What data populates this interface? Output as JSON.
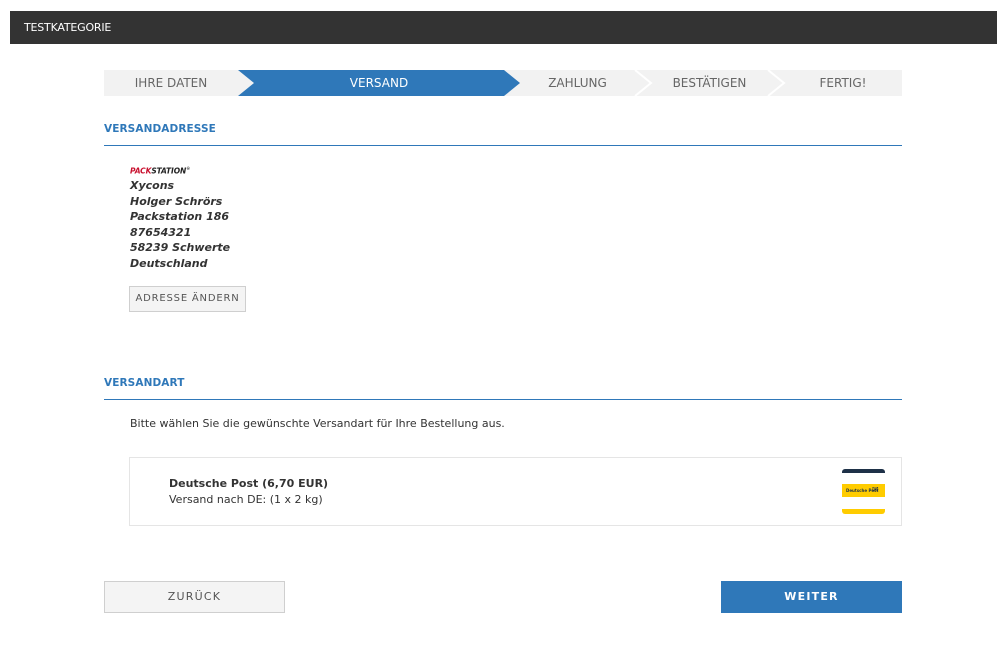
{
  "header": {
    "title": "TESTKATEGORIE"
  },
  "checkout_steps": [
    {
      "label": "IHRE DATEN",
      "active": false
    },
    {
      "label": "VERSAND",
      "active": true
    },
    {
      "label": "ZAHLUNG",
      "active": false
    },
    {
      "label": "BESTÄTIGEN",
      "active": false
    },
    {
      "label": "FERTIG!",
      "active": false
    }
  ],
  "shipping_address": {
    "section_title": "VERSANDADRESSE",
    "logo": {
      "pack": "PACK",
      "station": "STATION"
    },
    "lines": [
      "Xycons",
      "Holger Schrörs",
      "Packstation 186",
      "87654321",
      "58239 Schwerte",
      "Deutschland"
    ],
    "change_button": "ADRESSE ÄNDERN"
  },
  "shipping_method": {
    "section_title": "VERSANDART",
    "instruction": "Bitte wählen Sie die gewünschte Versandart für Ihre Bestellung aus.",
    "options": [
      {
        "name": "Deutsche Post (6,70 EUR)",
        "description": "Versand nach DE: (1 x 2 kg)",
        "logo_text": "Deutsche Post"
      }
    ]
  },
  "navigation": {
    "back": "ZURÜCK",
    "next": "WEITER"
  },
  "colors": {
    "accent": "#2f78b9",
    "topbar": "#333333",
    "step_bg": "#f2f2f2",
    "logo_yellow": "#ffcc00",
    "logo_red": "#c8102e"
  }
}
